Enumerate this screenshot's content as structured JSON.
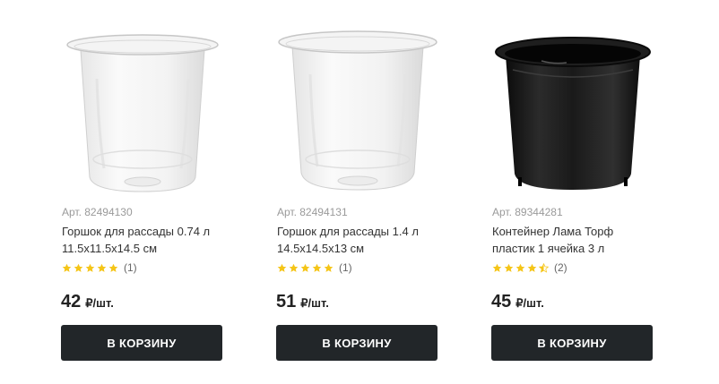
{
  "products": [
    {
      "sku": "Арт. 82494130",
      "title": "Горшок для рассады 0.74 л 11.5x11.5x14.5 см",
      "rating": 5,
      "reviews": "(1)",
      "price": "42",
      "unit": "₽/шт.",
      "button": "В КОРЗИНУ",
      "image": "clear-plastic-pot-icon"
    },
    {
      "sku": "Арт. 82494131",
      "title": "Горшок для рассады 1.4 л 14.5x14.5x13 см",
      "rating": 5,
      "reviews": "(1)",
      "price": "51",
      "unit": "₽/шт.",
      "button": "В КОРЗИНУ",
      "image": "clear-plastic-pot-icon"
    },
    {
      "sku": "Арт. 89344281",
      "title": "Контейнер Лама Торф пластик 1 ячейка 3 л",
      "rating": 4.5,
      "reviews": "(2)",
      "price": "45",
      "unit": "₽/шт.",
      "button": "В КОРЗИНУ",
      "image": "black-plastic-pot-icon"
    }
  ],
  "colors": {
    "star": "#f5c518",
    "button_bg": "#222629",
    "button_text": "#ffffff"
  }
}
